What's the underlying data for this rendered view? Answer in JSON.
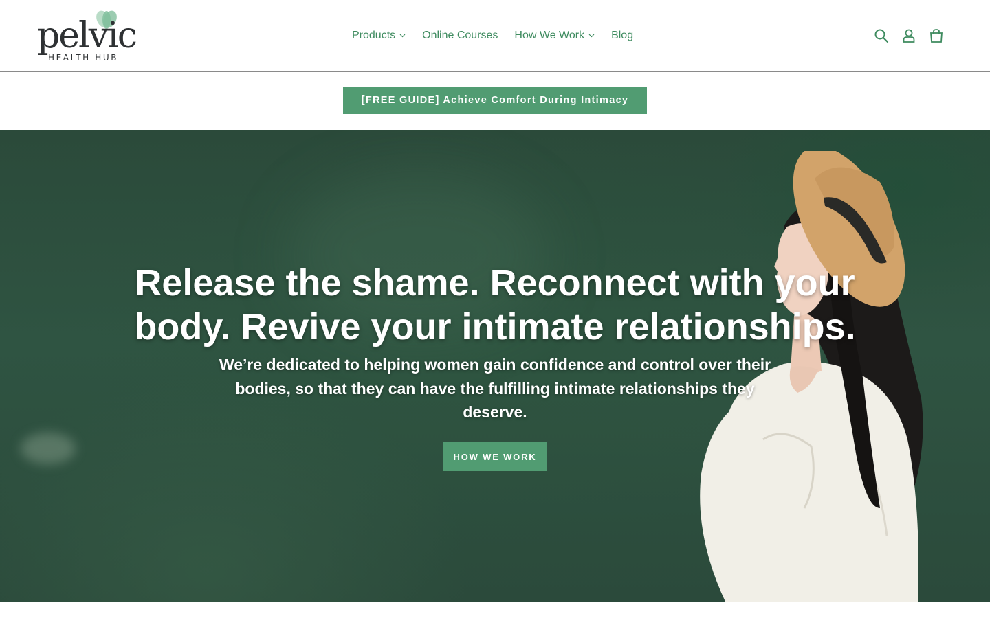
{
  "brand": {
    "logo_word": "pelvic",
    "logo_sub": "HEALTH HUB",
    "accent": "#519c72",
    "nav_color": "#3e8b5f"
  },
  "nav": {
    "items": [
      {
        "label": "Products",
        "has_dropdown": true
      },
      {
        "label": "Online Courses",
        "has_dropdown": false
      },
      {
        "label": "How We Work",
        "has_dropdown": true
      },
      {
        "label": "Blog",
        "has_dropdown": false
      }
    ]
  },
  "header_icons": [
    "search-icon",
    "account-icon",
    "cart-icon"
  ],
  "promo": {
    "label": "[FREE GUIDE] Achieve Comfort During Intimacy"
  },
  "hero": {
    "title": "Release the shame. Reconnect with your body. Revive your intimate relationships.",
    "subtitle": "We’re dedicated to helping women gain confidence and control over their bodies, so that they can have the fulfilling intimate relationships they deserve.",
    "cta_label": "HOW WE WORK"
  }
}
